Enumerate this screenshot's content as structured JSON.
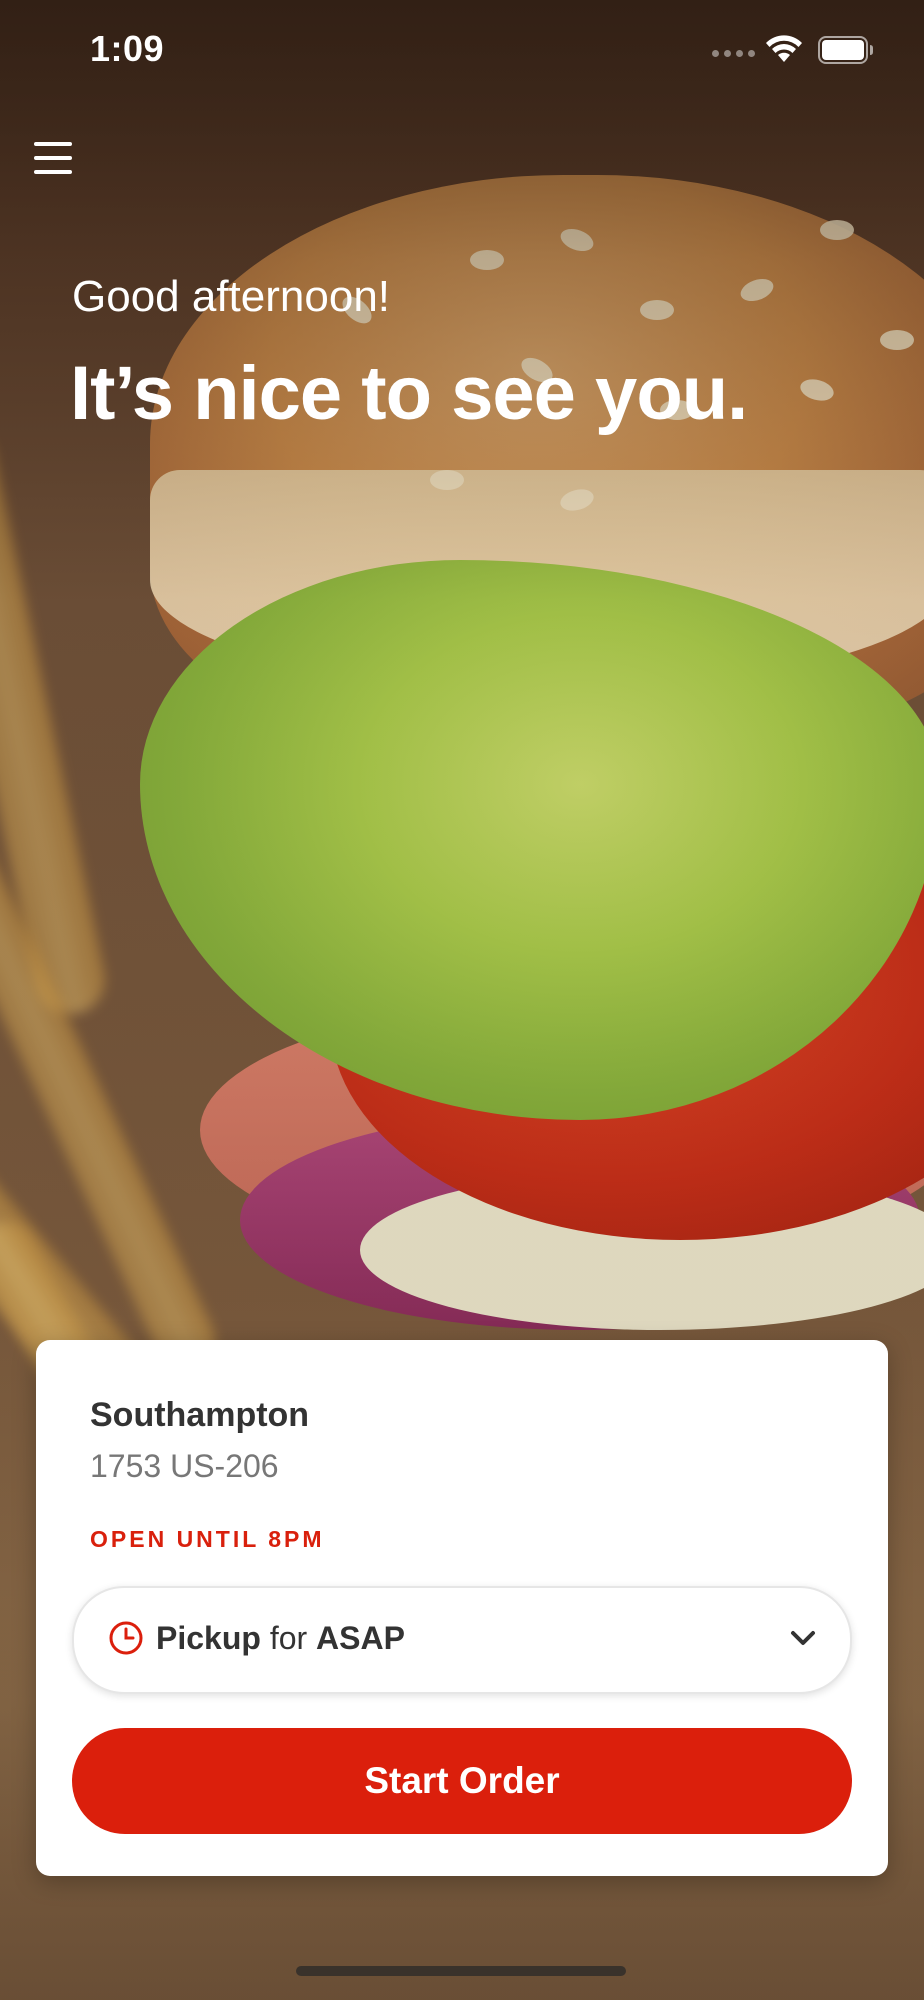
{
  "status_bar": {
    "time": "1:09",
    "icons": [
      "signal-icon",
      "wifi-icon",
      "battery-icon"
    ]
  },
  "header": {
    "menu_icon": "menu-icon"
  },
  "greeting": {
    "subtitle": "Good afternoon!",
    "title": "It’s nice to see you."
  },
  "store_card": {
    "name": "Southampton",
    "address": "1753 US-206",
    "hours": "OPEN UNTIL 8PM",
    "order_mode": {
      "icon": "clock-icon",
      "method": "Pickup",
      "connector": "for",
      "time": "ASAP"
    },
    "cta_label": "Start Order"
  },
  "colors": {
    "accent": "#db1f0c",
    "card_bg": "#ffffff",
    "primary_text": "#333333",
    "secondary_text": "#777777"
  }
}
